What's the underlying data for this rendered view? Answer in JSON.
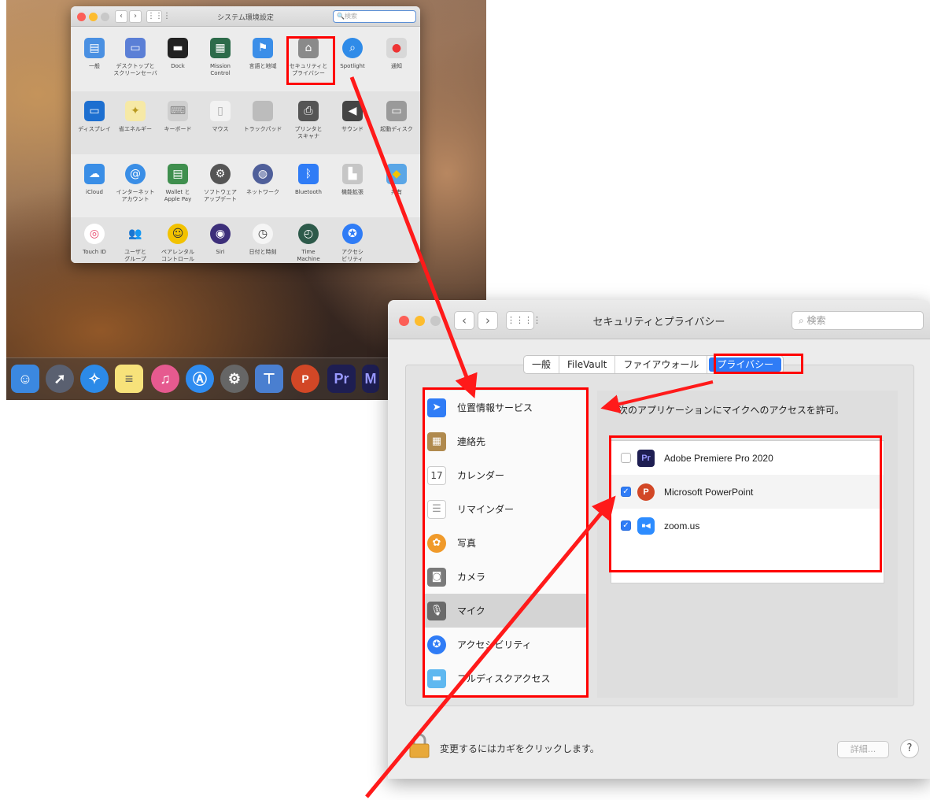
{
  "sysprefs": {
    "title": "システム環境設定",
    "search_placeholder": "検索",
    "rows": [
      [
        "一般",
        "デスクトップと\nスクリーンセーバ",
        "Dock",
        "Mission\nControl",
        "言語と地域",
        "セキュリティと\nプライバシー",
        "Spotlight",
        "通知"
      ],
      [
        "ディスプレイ",
        "省エネルギー",
        "キーボード",
        "マウス",
        "トラックパッド",
        "プリンタと\nスキャナ",
        "サウンド",
        "起動ディスク"
      ],
      [
        "iCloud",
        "インターネット\nアカウント",
        "Wallet と\nApple Pay",
        "ソフトウェア\nアップデート",
        "ネットワーク",
        "Bluetooth",
        "機能拡張",
        "共有"
      ],
      [
        "Touch ID",
        "ユーザと\nグループ",
        "ペアレンタル\nコントロール",
        "Siri",
        "日付と時刻",
        "Time\nMachine",
        "アクセシ\nビリティ"
      ]
    ]
  },
  "security": {
    "title": "セキュリティとプライバシー",
    "search_placeholder": "検索",
    "tabs": [
      "一般",
      "FileVault",
      "ファイアウォール",
      "プライバシー"
    ],
    "services": [
      "位置情報サービス",
      "連絡先",
      "カレンダー",
      "リマインダー",
      "写真",
      "カメラ",
      "マイク",
      "アクセシビリティ",
      "フルディスクアクセス"
    ],
    "mic_message": "次のアプリケーションにマイクへのアクセスを許可。",
    "apps": [
      {
        "name": "Adobe Premiere Pro 2020",
        "icon": "Pr",
        "checked": false
      },
      {
        "name": "Microsoft PowerPoint",
        "icon": "P",
        "checked": true
      },
      {
        "name": "zoom.us",
        "icon": "■◀",
        "checked": true
      }
    ],
    "lock_message": "変更するにはカギをクリックします。",
    "advanced_label": "詳細...",
    "help_label": "?"
  },
  "calendar_day": "17",
  "dock_labels": {
    "premiere": "Pr",
    "m": "M"
  },
  "colors": {
    "highlight": "#ff0000",
    "accent": "#2f7cf6"
  }
}
